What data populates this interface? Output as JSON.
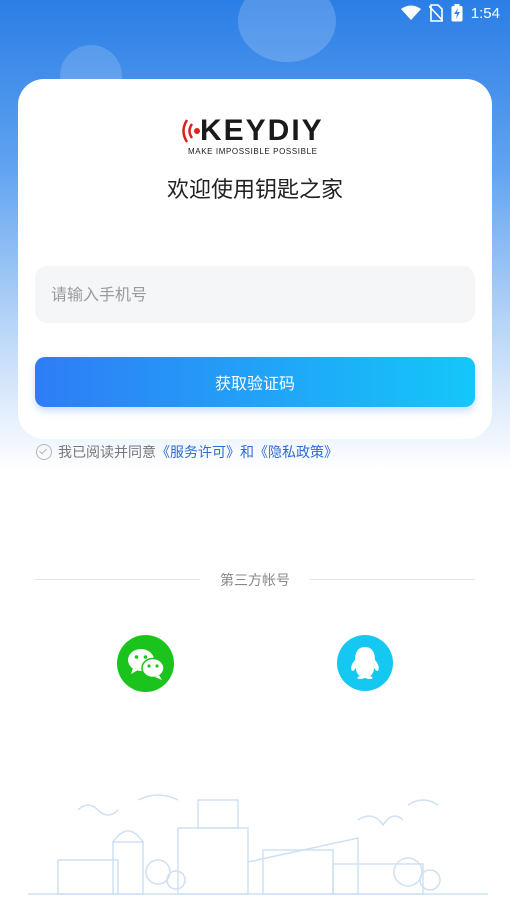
{
  "status_bar": {
    "time": "1:54"
  },
  "logo": {
    "brand": "KEYDIY",
    "tagline": "MAKE IMPOSSIBLE POSSIBLE"
  },
  "welcome_text": "欢迎使用钥匙之家",
  "phone_input": {
    "placeholder": "请输入手机号",
    "value": ""
  },
  "get_code_button": "获取验证码",
  "agreement": {
    "prefix": "我已阅读并同意",
    "service_link": "《服务许可》",
    "conjunction": "和",
    "privacy_link": "《隐私政策》"
  },
  "third_party": {
    "label": "第三方帐号",
    "providers": [
      "wechat",
      "qq"
    ]
  },
  "colors": {
    "accent_start": "#2f7cf6",
    "accent_end": "#14c7f9",
    "wechat": "#1bc41d",
    "qq": "#14c8f1",
    "link": "#2f6bd6"
  }
}
